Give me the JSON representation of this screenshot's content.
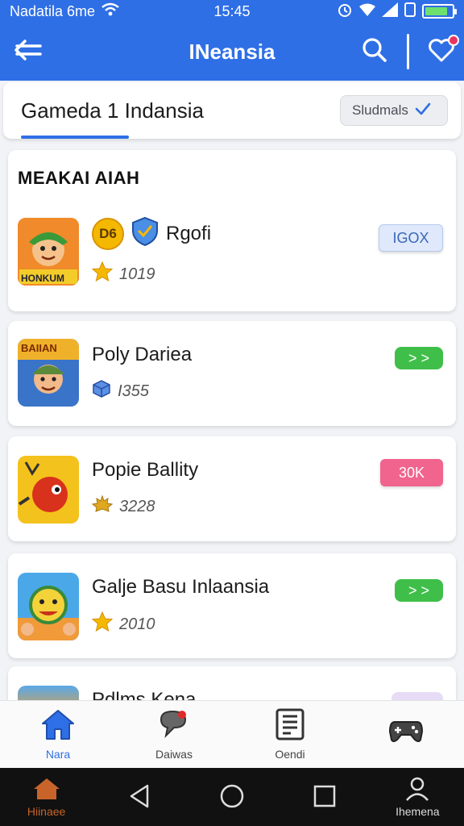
{
  "status_bar": {
    "carrier": "Nadatila 6me",
    "time": "15:45",
    "battery_level": 0.75,
    "icons": [
      "wifi-icon",
      "alarm-icon",
      "wifi-icon",
      "signal-icon",
      "battery-icon"
    ]
  },
  "app_bar": {
    "title": "INeansia",
    "icons": [
      "back-arrow-icon",
      "search-icon",
      "heart-icon"
    ]
  },
  "header": {
    "title": "Gameda 1 Indansia",
    "sort_label": "Sludmals"
  },
  "section": {
    "title": "MEAKAI AIAH"
  },
  "games": [
    {
      "name": "Rgofi",
      "badge_text": "D6",
      "stat": "1019",
      "stat_icon": "star-icon",
      "action_label": "IGOX",
      "action_style": "blue",
      "thumb_caption": "HONKUM"
    },
    {
      "name": "Poly Dariea",
      "stat": "I355",
      "stat_icon": "cube-icon",
      "action_label": "> >",
      "action_style": "green",
      "thumb_caption": "BAIIAN"
    },
    {
      "name": "Popie Ballity",
      "stat": "3228",
      "stat_icon": "maple-leaf-icon",
      "action_label": "30K",
      "action_style": "pink"
    },
    {
      "name": "Galje Basu Inlaansia",
      "stat": "2010",
      "stat_icon": "star-icon",
      "action_label": "> >",
      "action_style": "green"
    },
    {
      "name": "Pdlms Kena",
      "action_style": "lavender"
    }
  ],
  "bottom_nav": [
    {
      "label": "Nara",
      "icon": "home-icon",
      "active": true
    },
    {
      "label": "Daiwas",
      "icon": "chat-icon",
      "active": false
    },
    {
      "label": "Oendi",
      "icon": "document-icon",
      "active": false
    },
    {
      "label": "",
      "icon": "gamepad-icon",
      "active": false
    }
  ],
  "system_nav": {
    "home_label": "Hiinaee",
    "profile_label": "Ihemena"
  },
  "colors": {
    "primary": "#2f6fe6",
    "green": "#3fbf49",
    "pink": "#f0648e",
    "star": "#f5b800"
  }
}
